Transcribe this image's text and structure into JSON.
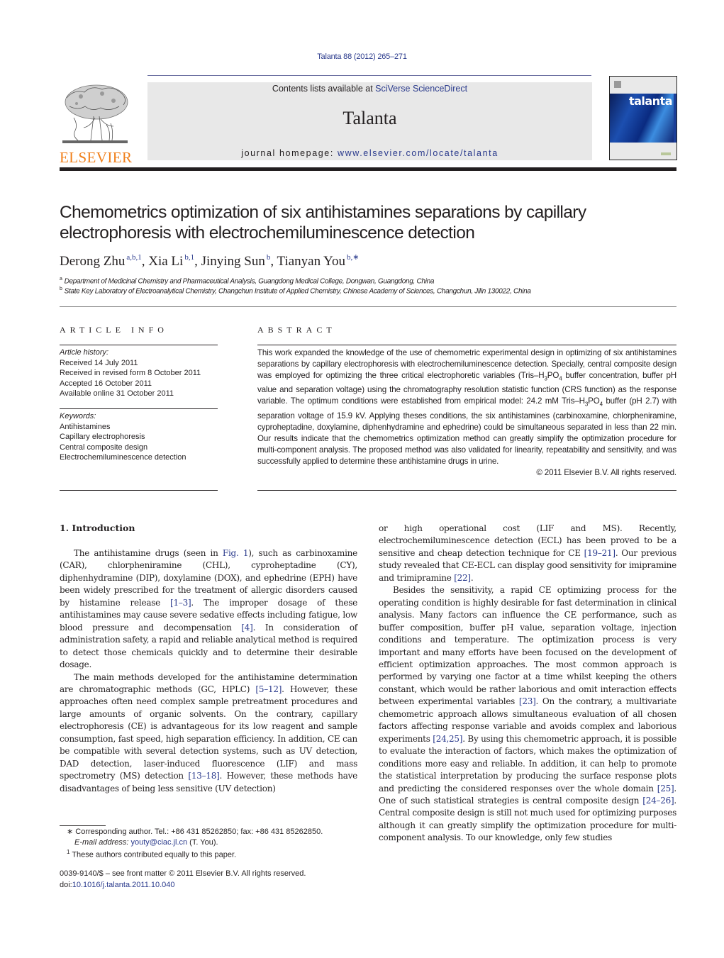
{
  "header": {
    "citation": "Talanta 88 (2012) 265–271",
    "contents_prefix": "Contents lists available at ",
    "contents_link": "SciVerse ScienceDirect",
    "journal_name": "Talanta",
    "homepage_prefix": "journal homepage: ",
    "homepage_link": "www.elsevier.com/locate/talanta",
    "publisher_logo_text": "ELSEVIER",
    "cover_title": "talanta",
    "brand_orange": "#f07f1a",
    "link_color": "#2a3a8c"
  },
  "article": {
    "title": "Chemometrics optimization of six antihistamines separations by capillary electrophoresis with electrochemiluminescence detection",
    "authors": [
      {
        "name": "Derong Zhu",
        "marks": "a,b,1",
        "sep": ", "
      },
      {
        "name": "Xia Li",
        "marks": "b,1",
        "sep": ", "
      },
      {
        "name": "Jinying Sun",
        "marks": "b",
        "sep": ", "
      },
      {
        "name": "Tianyan You",
        "marks": "b,∗",
        "sep": ""
      }
    ],
    "affiliations": [
      {
        "mark": "a",
        "text": "Department of Medicinal Chemistry and Pharmaceutical Analysis, Guangdong Medical College, Dongwan, Guangdong, China"
      },
      {
        "mark": "b",
        "text": "State Key Laboratory of Electroanalytical Chemistry, Changchun Institute of Applied Chemistry, Chinese Academy of Sciences, Changchun, Jilin 130022, China"
      }
    ]
  },
  "article_info": {
    "heading": "ARTICLE INFO",
    "history_label": "Article history:",
    "history": [
      "Received 14 July 2011",
      "Received in revised form 8 October 2011",
      "Accepted 16 October 2011",
      "Available online 31 October 2011"
    ],
    "keywords_label": "Keywords:",
    "keywords": [
      "Antihistamines",
      "Capillary electrophoresis",
      "Central composite design",
      "Electrochemiluminescence detection"
    ]
  },
  "abstract": {
    "heading": "ABSTRACT",
    "p1": "This work expanded the knowledge of the use of chemometric experimental design in optimizing of six antihistamines separations by capillary electrophoresis with electrochemiluminescence detection. Specially, central composite design was employed for optimizing the three critical electrophoretic variables (Tris–H",
    "p2": "PO",
    "p3": " buffer concentration, buffer pH value and separation voltage) using the chromatography resolution statistic function (CRS function) as the response variable. The optimum conditions were established from empirical model: 24.2 mM Tris–H",
    "p4": "PO",
    "p5": " buffer (pH 2.7) with separation voltage of 15.9 kV. Applying theses conditions, the six antihistamines (carbinoxamine, chlorpheniramine, cyproheptadine, doxylamine, diphenhydramine and ephedrine) could be simultaneous separated in less than 22 min. Our results indicate that the chemometrics optimization method can greatly simplify the optimization procedure for multi-component analysis. The proposed method was also validated for linearity, repeatability and sensitivity, and was successfully applied to determine these antihistamine drugs in urine.",
    "sub3": "3",
    "sub4": "4",
    "copyright": "© 2011 Elsevier B.V. All rights reserved."
  },
  "intro": {
    "heading": "1.  Introduction",
    "left_p1": [
      {
        "t": "The antihistamine drugs (seen in "
      },
      {
        "l": "Fig. 1"
      },
      {
        "t": "), such as carbinoxamine (CAR), chlorpheniramine (CHL), cyproheptadine (CY), diphenhydramine (DIP), doxylamine (DOX), and ephedrine (EPH) have been widely prescribed for the treatment of allergic disorders caused by histamine release "
      },
      {
        "l": "[1–3]"
      },
      {
        "t": ". The improper dosage of these antihistamines may cause severe sedative effects including fatigue, low blood pressure and decompensation "
      },
      {
        "l": "[4]"
      },
      {
        "t": ". In consideration of administration safety, a rapid and reliable analytical method is required to detect those chemicals quickly and to determine their desirable dosage."
      }
    ],
    "left_p2": [
      {
        "t": "The main methods developed for the antihistamine determination are chromatographic methods (GC, HPLC) "
      },
      {
        "l": "[5–12]"
      },
      {
        "t": ". However, these approaches often need complex sample pretreatment procedures and large amounts of organic solvents. On the contrary, capillary electrophoresis (CE) is advantageous for its low reagent and sample consumption, fast speed, high separation efficiency. In addition, CE can be compatible with several detection systems, such as UV detection, DAD detection, laser-induced fluorescence (LIF) and mass spectrometry (MS) detection "
      },
      {
        "l": "[13–18]"
      },
      {
        "t": ". However, these methods have disadvantages of being less sensitive (UV detection)"
      }
    ],
    "right_p1": [
      {
        "t": "or high operational cost (LIF and MS). Recently, electrochemiluminescence detection (ECL) has been proved to be a sensitive and cheap detection technique for CE "
      },
      {
        "l": "[19–21]"
      },
      {
        "t": ". Our previous study revealed that CE-ECL can display good sensitivity for imipramine and trimipramine "
      },
      {
        "l": "[22]"
      },
      {
        "t": "."
      }
    ],
    "right_p2": [
      {
        "t": "Besides the sensitivity, a rapid CE optimizing process for the operating condition is highly desirable for fast determination in clinical analysis. Many factors can influence the CE performance, such as buffer composition, buffer pH value, separation voltage, injection conditions and temperature. The optimization process is very important and many efforts have been focused on the development of efficient optimization approaches. The most common approach is performed by varying one factor at a time whilst keeping the others constant, which would be rather laborious and omit interaction effects between experimental variables "
      },
      {
        "l": "[23]"
      },
      {
        "t": ". On the contrary, a multivariate chemometric approach allows simultaneous evaluation of all chosen factors affecting response variable and avoids complex and laborious experiments "
      },
      {
        "l": "[24,25]"
      },
      {
        "t": ". By using this chemometric approach, it is possible to evaluate the interaction of factors, which makes the optimization of conditions more easy and reliable. In addition, it can help to promote the statistical interpretation by producing the surface response plots and predicting the considered responses over the whole domain "
      },
      {
        "l": "[25]"
      },
      {
        "t": ". One of such statistical strategies is central composite design "
      },
      {
        "l": "[24–26]"
      },
      {
        "t": ". Central composite design is still not much used for optimizing purposes although it can greatly simplify the optimization procedure for multi-component analysis. To our knowledge, only few studies"
      }
    ]
  },
  "footnotes": {
    "corresponding": "Corresponding author. Tel.: +86 431 85262850; fax: +86 431 85262850.",
    "corresponding_mark": "∗",
    "email_label": "E-mail address: ",
    "email": "youty@ciac.jl.cn",
    "email_suffix": " (T. You).",
    "equal_mark": "1",
    "equal": "These authors contributed equally to this paper."
  },
  "front_matter": {
    "issn_line": "0039-9140/$ – see front matter © 2011 Elsevier B.V. All rights reserved.",
    "doi_prefix": "doi:",
    "doi": "10.1016/j.talanta.2011.10.040"
  }
}
